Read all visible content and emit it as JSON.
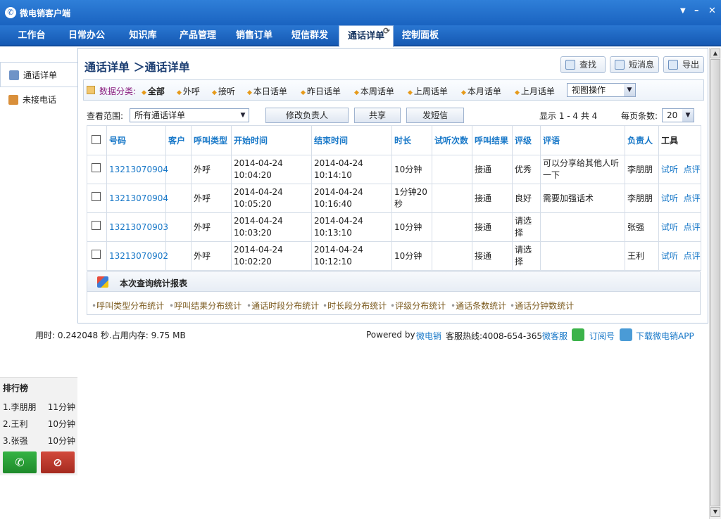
{
  "app": {
    "title": "微电销客户端",
    "win_menu": "▼",
    "win_min": "–",
    "win_close": "✕"
  },
  "nav": {
    "tabs": [
      "工作台",
      "日常办公",
      "知识库",
      "产品管理",
      "销售订单",
      "短信群发",
      "通话详单",
      "控制面板"
    ],
    "active_index": 6
  },
  "sidebar": {
    "items": [
      "通话详单",
      "未接电话"
    ]
  },
  "header": {
    "breadcrumb": "通话详单 ＞通话详单",
    "buttons": [
      "查找",
      "短消息",
      "导出"
    ]
  },
  "filter": {
    "label": "数据分类:",
    "options": [
      "全部",
      "外呼",
      "接听",
      "本日话单",
      "昨日话单",
      "本周话单",
      "上周话单",
      "本月话单",
      "上月话单"
    ],
    "selected": "全部",
    "view_select": "视图操作"
  },
  "range": {
    "label": "查看范围:",
    "value": "所有通话详单",
    "actions": [
      "修改负责人",
      "共享",
      "发短信"
    ],
    "summary": "显示 1 - 4 共 4",
    "page_size_label": "每页条数:",
    "page_size": "20"
  },
  "table": {
    "headers": [
      "号码",
      "客户",
      "呼叫类型",
      "开始时间",
      "结束时间",
      "时长",
      "试听次数",
      "呼叫结果",
      "评级",
      "评语",
      "负责人",
      "工具"
    ],
    "rows": [
      {
        "number": "13213070904",
        "customer": "",
        "type": "外呼",
        "start_date": "2014-04-24",
        "start_time": "10:04:20",
        "end_date": "2014-04-24",
        "end_time": "10:14:10",
        "duration": "10分钟",
        "listen": "",
        "result": "接通",
        "rating": "优秀",
        "comment": "可以分享给其他人听一下",
        "owner": "李朋朋",
        "tool1": "试听",
        "tool2": "点评"
      },
      {
        "number": "13213070904",
        "customer": "",
        "type": "外呼",
        "start_date": "2014-04-24",
        "start_time": "10:05:20",
        "end_date": "2014-04-24",
        "end_time": "10:16:40",
        "duration": "1分钟20秒",
        "listen": "",
        "result": "接通",
        "rating": "良好",
        "comment": "需要加强话术",
        "owner": "李朋朋",
        "tool1": "试听",
        "tool2": "点评"
      },
      {
        "number": "13213070903",
        "customer": "",
        "type": "外呼",
        "start_date": "2014-04-24",
        "start_time": "10:03:20",
        "end_date": "2014-04-24",
        "end_time": "10:13:10",
        "duration": "10分钟",
        "listen": "",
        "result": "接通",
        "rating": "请选择",
        "comment": "",
        "owner": "张强",
        "tool1": "试听",
        "tool2": "点评"
      },
      {
        "number": "13213070902",
        "customer": "",
        "type": "外呼",
        "start_date": "2014-04-24",
        "start_time": "10:02:20",
        "end_date": "2014-04-24",
        "end_time": "10:12:10",
        "duration": "10分钟",
        "listen": "",
        "result": "接通",
        "rating": "请选择",
        "comment": "",
        "owner": "王利",
        "tool1": "试听",
        "tool2": "点评"
      }
    ]
  },
  "stats": {
    "title": "本次查询统计报表",
    "links": [
      "呼叫类型分布统计",
      "呼叫结果分布统计",
      "通话时段分布统计",
      "时长段分布统计",
      "评级分布统计",
      "通话条数统计",
      "通话分钟数统计"
    ]
  },
  "footer": {
    "perf": "用时: 0.242048 秒.占用内存: 9.75 MB",
    "powered_prefix": "Powered by",
    "brand": "微电销",
    "hotline": "客服热线:4008-654-365",
    "service": "微客服",
    "subscribe": "订阅号",
    "download": "下载微电销APP"
  },
  "ranking": {
    "title": "排行榜",
    "rows": [
      {
        "name": "1.李朋朋",
        "time": "11分钟"
      },
      {
        "name": "2.王利",
        "time": "10分钟"
      },
      {
        "name": "3.张强",
        "time": "10分钟"
      }
    ]
  },
  "colors": {
    "titlebar": "#1a63c0",
    "link": "#1878c8",
    "answer_button": "#1e9a2c",
    "hangup_button": "#c0392b"
  }
}
